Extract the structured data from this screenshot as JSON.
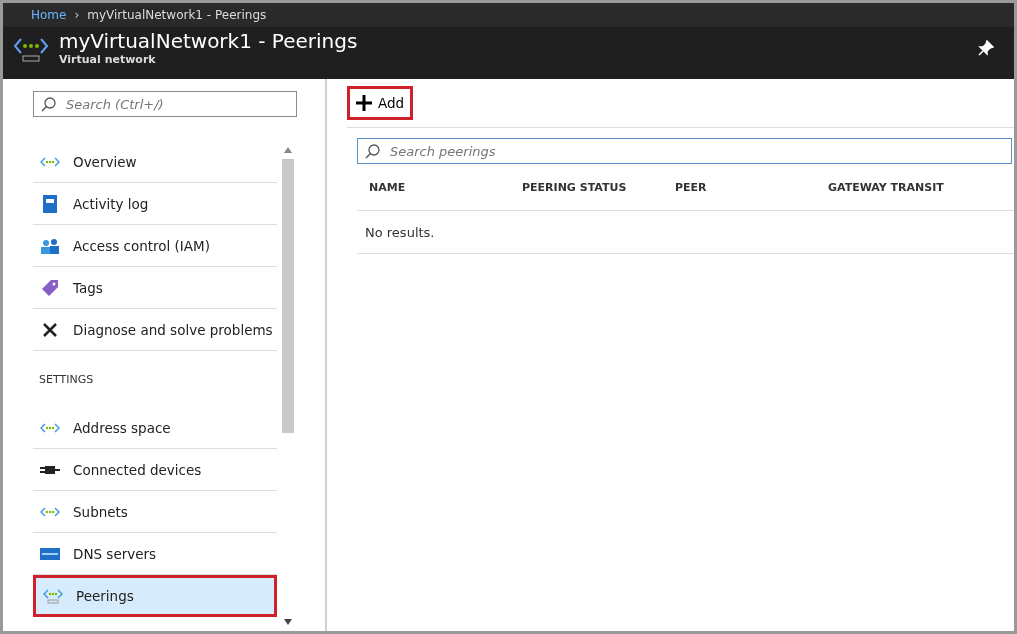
{
  "breadcrumb": [
    {
      "label": "Home",
      "link": true
    },
    {
      "label": "myVirtualNetwork1 - Peerings",
      "link": false
    }
  ],
  "breadcrumb_separator": "›",
  "header": {
    "title": "myVirtualNetwork1 - Peerings",
    "subtitle": "Virtual network"
  },
  "sidebar": {
    "search": {
      "placeholder": "Search (Ctrl+/)"
    },
    "items": [
      {
        "kind": "item",
        "label": "Overview",
        "selected": false,
        "highlighted": false
      },
      {
        "kind": "item",
        "label": "Activity log",
        "selected": false,
        "highlighted": false
      },
      {
        "kind": "item",
        "label": "Access control (IAM)",
        "selected": false,
        "highlighted": false
      },
      {
        "kind": "item",
        "label": "Tags",
        "selected": false,
        "highlighted": false
      },
      {
        "kind": "item",
        "label": "Diagnose and solve problems",
        "selected": false,
        "highlighted": false
      },
      {
        "kind": "section",
        "label": "SETTINGS"
      },
      {
        "kind": "item",
        "label": "Address space",
        "selected": false,
        "highlighted": false
      },
      {
        "kind": "item",
        "label": "Connected devices",
        "selected": false,
        "highlighted": false
      },
      {
        "kind": "item",
        "label": "Subnets",
        "selected": false,
        "highlighted": false
      },
      {
        "kind": "item",
        "label": "DNS servers",
        "selected": false,
        "highlighted": false
      },
      {
        "kind": "item",
        "label": "Peerings",
        "selected": true,
        "highlighted": true
      }
    ]
  },
  "toolbar": {
    "add": {
      "label": "Add",
      "highlighted": true
    }
  },
  "search": {
    "placeholder": "Search peerings"
  },
  "table": {
    "columns": [
      "NAME",
      "PEERING STATUS",
      "PEER",
      "GATEWAY TRANSIT"
    ],
    "empty": "No results."
  }
}
